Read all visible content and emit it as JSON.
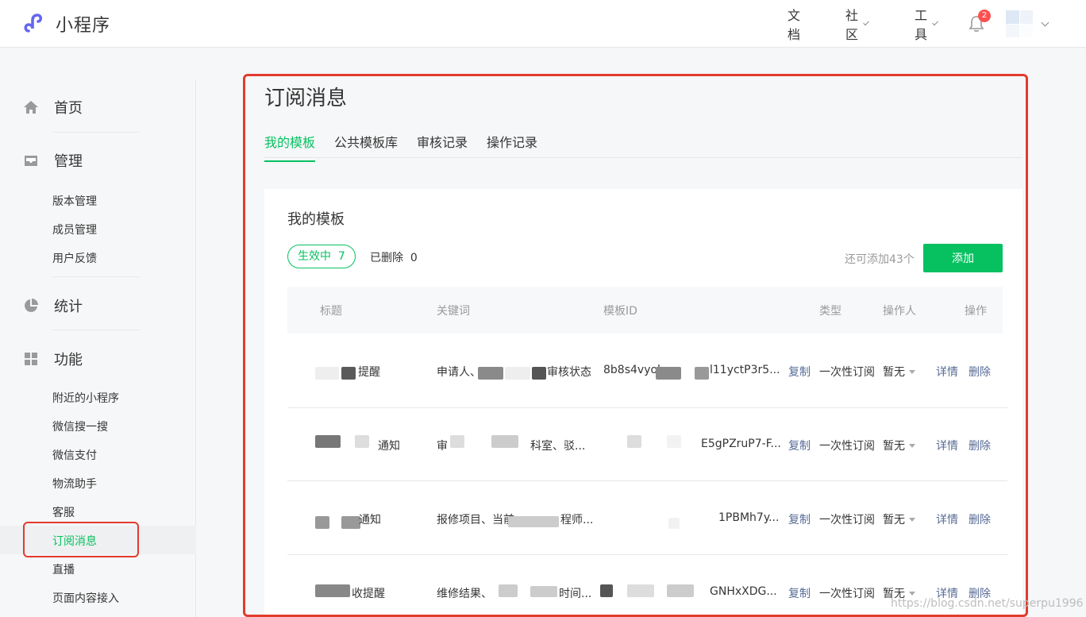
{
  "app": {
    "logo_text": "小程序"
  },
  "topnav": {
    "docs": "文档",
    "community": "社区",
    "tools": "工具",
    "notifications": "2"
  },
  "sidebar": {
    "home": "首页",
    "manage": "管理",
    "manage_items": [
      "版本管理",
      "成员管理",
      "用户反馈"
    ],
    "stats": "统计",
    "features": "功能",
    "feature_items": [
      "附近的小程序",
      "微信搜一搜",
      "微信支付",
      "物流助手",
      "客服",
      "订阅消息",
      "直播",
      "页面内容接入"
    ]
  },
  "main": {
    "title": "订阅消息",
    "tabs": [
      "我的模板",
      "公共模板库",
      "审核记录",
      "操作记录"
    ],
    "card_title": "我的模板",
    "active_filter": "生效中",
    "active_count": "7",
    "deleted_filter": "已删除",
    "deleted_count": "0",
    "remaining": "还可添加43个",
    "add_button": "添加"
  },
  "table": {
    "headers": [
      "标题",
      "关键词",
      "模板ID",
      "类型",
      "操作人",
      "操作"
    ],
    "rows": [
      {
        "title": "提醒",
        "keywords_a": "申请人、",
        "keywords_b": "审核状态",
        "id_a": "8b8s4vyol",
        "id_b": "l11yctP3r5...",
        "copy": "复制",
        "type": "一次性订阅",
        "operator": "暂无",
        "detail": "详情",
        "delete": "删除"
      },
      {
        "title": "通知",
        "keywords_a": "审",
        "keywords_b": "科室、驳...",
        "id_a": "",
        "id_b": "E5gPZruP7-F...",
        "copy": "复制",
        "type": "一次性订阅",
        "operator": "暂无",
        "detail": "详情",
        "delete": "删除"
      },
      {
        "title": "通知",
        "keywords_a": "报修项目、当前",
        "keywords_b": "程师...",
        "id_a": "",
        "id_b": "1PBMh7y...",
        "copy": "复制",
        "type": "一次性订阅",
        "operator": "暂无",
        "detail": "详情",
        "delete": "删除"
      },
      {
        "title": "收提醒",
        "keywords_a": "维修结果、",
        "keywords_b": "时间...",
        "id_a": "",
        "id_b": "GNHxXDG...",
        "copy": "复制",
        "type": "一次性订阅",
        "operator": "暂无",
        "detail": "详情",
        "delete": "删除"
      }
    ]
  },
  "watermark": "https://blog.csdn.net/superpu1996",
  "colors": {
    "accent": "#07c160",
    "link": "#576b95",
    "highlight": "#e33b2e"
  }
}
